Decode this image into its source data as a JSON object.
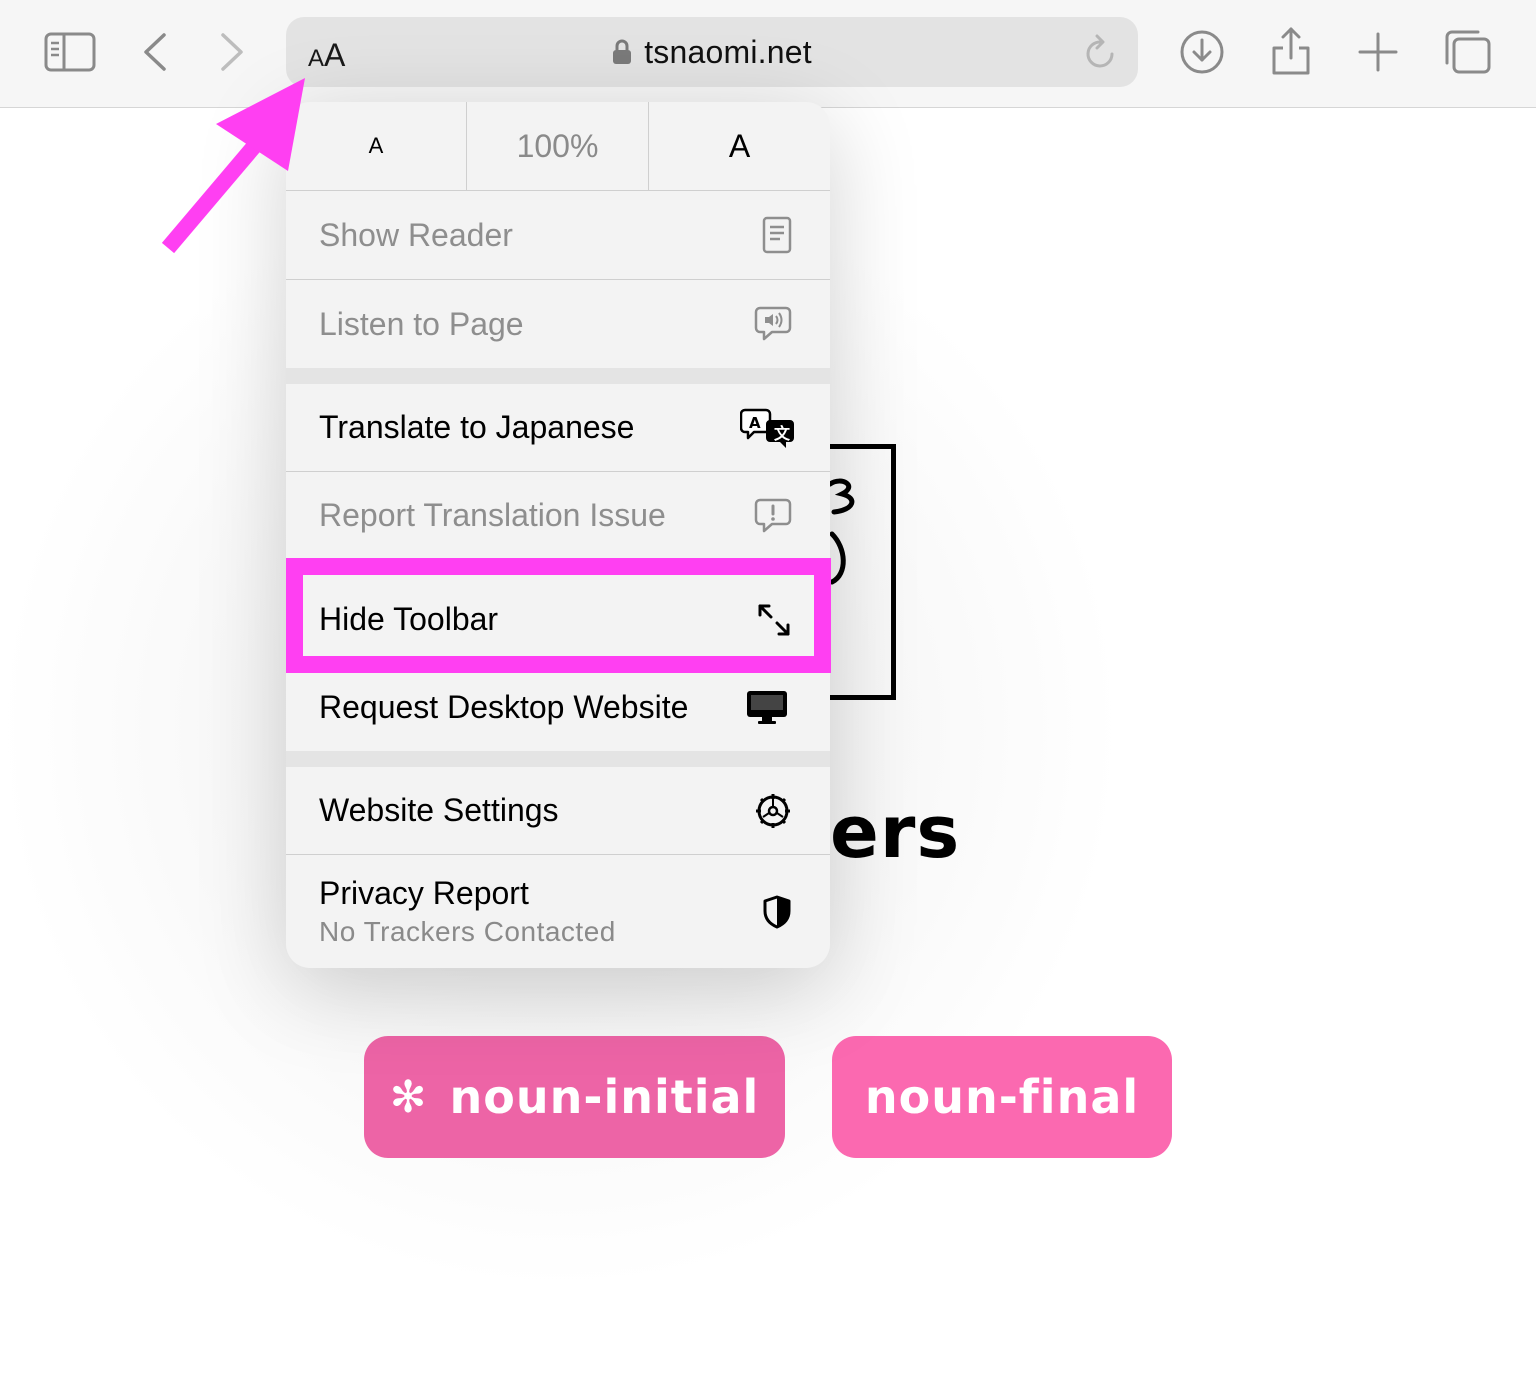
{
  "browser": {
    "text_size_label_small": "A",
    "text_size_label_large": "A",
    "url": "tsnaomi.net",
    "icons": {
      "sidebar": "sidebar-icon",
      "back": "chevron-left-icon",
      "forward": "chevron-right-icon",
      "lock": "lock-icon",
      "reload": "reload-icon",
      "downloads": "download-icon",
      "share": "share-icon",
      "new_tab": "plus-icon",
      "tabs": "tabs-icon"
    }
  },
  "menu": {
    "zoom": {
      "decrease": "A",
      "level": "100%",
      "increase": "A"
    },
    "items": [
      {
        "label": "Show Reader",
        "icon": "reader-icon",
        "enabled": false
      },
      {
        "label": "Listen to Page",
        "icon": "speaker-bubble-icon",
        "enabled": false
      },
      {
        "label": "Translate to Japanese",
        "icon": "translate-icon",
        "enabled": true
      },
      {
        "label": "Report Translation Issue",
        "icon": "exclamation-bubble-icon",
        "enabled": false
      },
      {
        "label": "Hide Toolbar",
        "icon": "expand-arrows-icon",
        "enabled": true
      },
      {
        "label": "Request Desktop Website",
        "icon": "desktop-icon",
        "enabled": true
      },
      {
        "label": "Website Settings",
        "icon": "gear-icon",
        "enabled": true
      },
      {
        "label": "Privacy Report",
        "sublabel": "No Trackers Contacted",
        "icon": "shield-icon",
        "enabled": true
      }
    ]
  },
  "page": {
    "heading_fragment": "ers",
    "buttons": [
      {
        "label": "noun-initial",
        "marker": "✻",
        "color": "#ed64a6"
      },
      {
        "label": "noun-final",
        "color": "#fb69b0"
      }
    ]
  },
  "annotation": {
    "color": "#ff3ff2",
    "highlighted_item": "Hide Toolbar"
  }
}
